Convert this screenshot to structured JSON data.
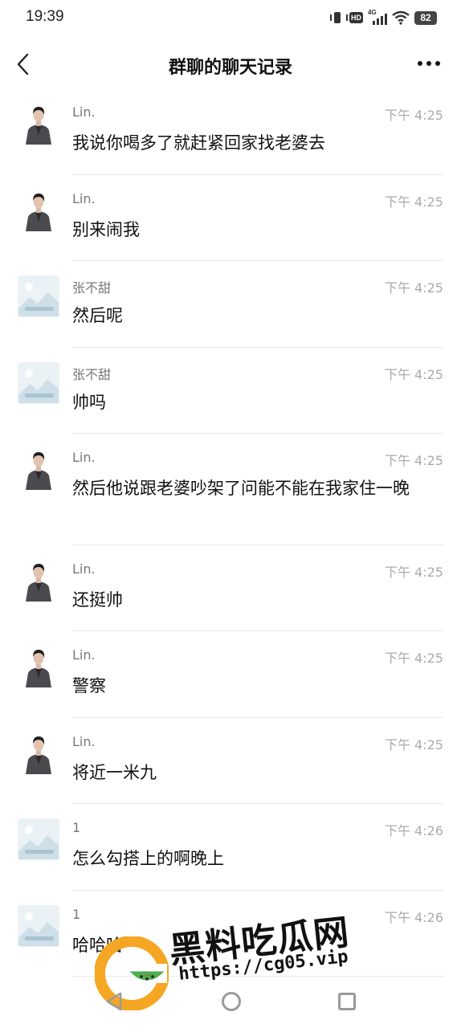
{
  "status_bar": {
    "time": "19:39",
    "network": "4G",
    "hd": "HD",
    "battery": "82"
  },
  "header": {
    "title": "群聊的聊天记录"
  },
  "messages": [
    {
      "sender": "Lin.",
      "time": "下午 4:25",
      "text": "我说你喝多了就赶紧回家找老婆去",
      "avatar": "man"
    },
    {
      "sender": "Lin.",
      "time": "下午 4:25",
      "text": "别来闹我",
      "avatar": "man"
    },
    {
      "sender": "张不甜",
      "time": "下午 4:25",
      "text": "然后呢",
      "avatar": "placeholder"
    },
    {
      "sender": "张不甜",
      "time": "下午 4:25",
      "text": "帅吗",
      "avatar": "placeholder"
    },
    {
      "sender": "Lin.",
      "time": "下午 4:25",
      "text": "然后他说跟老婆吵架了问能不能在我家住一晚",
      "avatar": "man"
    },
    {
      "sender": "Lin.",
      "time": "下午 4:25",
      "text": "还挺帅",
      "avatar": "man"
    },
    {
      "sender": "Lin.",
      "time": "下午 4:25",
      "text": "警察",
      "avatar": "man"
    },
    {
      "sender": "Lin.",
      "time": "下午 4:25",
      "text": "将近一米九",
      "avatar": "man"
    },
    {
      "sender": "1",
      "time": "下午 4:26",
      "text": "怎么勾搭上的啊晚上",
      "avatar": "placeholder"
    },
    {
      "sender": "1",
      "time": "下午 4:26",
      "text": "哈哈哈",
      "avatar": "placeholder"
    }
  ],
  "watermark": {
    "title": "黑料吃瓜网",
    "url": "https://cg05.vip"
  },
  "colors": {
    "watermark_orange": "#f5a623",
    "watermark_green": "#4caf50",
    "watermark_red": "#e53935"
  }
}
